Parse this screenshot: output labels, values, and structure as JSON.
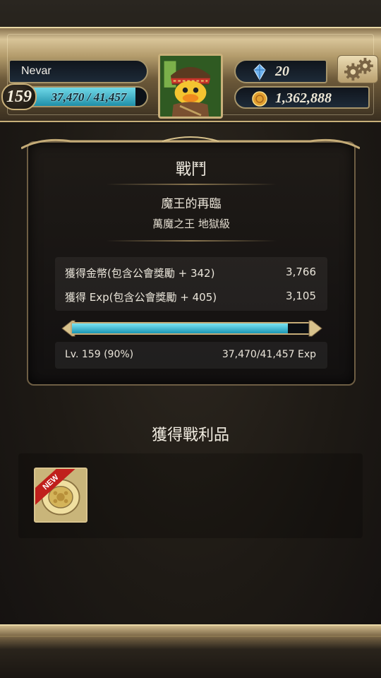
{
  "player": {
    "name": "Nevar",
    "level": "159",
    "exp_text": "37,470 / 41,457",
    "exp_fraction": 0.904
  },
  "currency": {
    "gems": "20",
    "gold": "1,362,888"
  },
  "icons": {
    "gem": "blue-crystal-icon",
    "gold": "gold-coin-icon",
    "settings": "gears-icon",
    "avatar": "duck-character-portrait"
  },
  "battle": {
    "title": "戰鬥",
    "quest_name": "魔王的再臨",
    "quest_sub": "萬魔之王 地獄級",
    "rewards": [
      {
        "label": "獲得金幣(包含公會獎勵 + 342)",
        "value": "3,766"
      },
      {
        "label": "獲得 Exp(包含公會獎勵 + 405)",
        "value": "3,105"
      }
    ],
    "progress_fraction": 0.9,
    "level_text": "Lv. 159 (90%)",
    "exp_text": "37,470/41,457 Exp"
  },
  "loot": {
    "title": "獲得戰利品",
    "items": [
      {
        "badge": "NEW",
        "icon": "gold-medal-icon"
      }
    ]
  },
  "colors": {
    "accent_cyan": "#1f9bb6",
    "frame_gold": "#c9b07a",
    "badge_red": "#c0201c"
  }
}
